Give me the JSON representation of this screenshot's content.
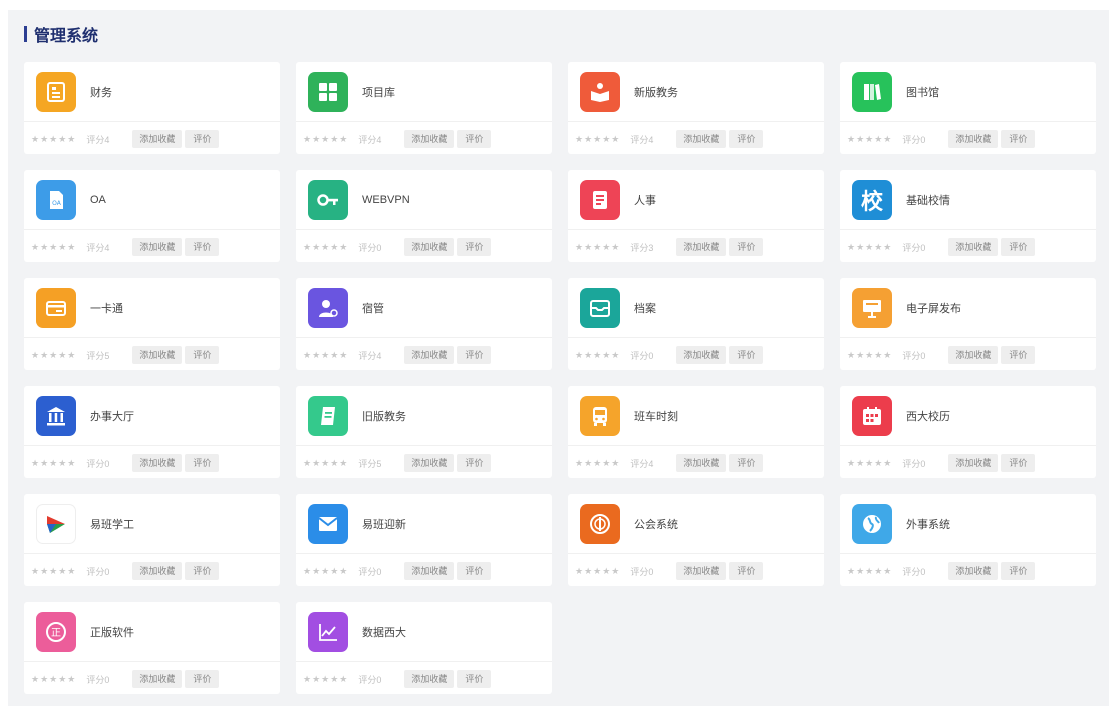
{
  "section": {
    "title": "管理系统"
  },
  "labels": {
    "add_favorite": "添加收藏",
    "rate": "评价",
    "stars": "★★★★★"
  },
  "apps": [
    {
      "name": "财务",
      "rating": "评分4",
      "icon": "finance-icon",
      "color": "#f5a623"
    },
    {
      "name": "项目库",
      "rating": "评分4",
      "icon": "grid-icon",
      "color": "#2fb25a"
    },
    {
      "name": "新版教务",
      "rating": "评分4",
      "icon": "reading-icon",
      "color": "#ef5b3a"
    },
    {
      "name": "图书馆",
      "rating": "评分0",
      "icon": "books-icon",
      "color": "#27c25b"
    },
    {
      "name": "OA",
      "rating": "评分4",
      "icon": "document-icon",
      "color": "#3d9ce8"
    },
    {
      "name": "WEBVPN",
      "rating": "评分0",
      "icon": "key-icon",
      "color": "#27b283"
    },
    {
      "name": "人事",
      "rating": "评分3",
      "icon": "form-icon",
      "color": "#ee4456"
    },
    {
      "name": "基础校情",
      "rating": "评分0",
      "icon": "campus-glyph-icon",
      "color": "#1f8ed6",
      "glyph": "校"
    },
    {
      "name": "一卡通",
      "rating": "评分5",
      "icon": "card-icon",
      "color": "#f5a025"
    },
    {
      "name": "宿管",
      "rating": "评分4",
      "icon": "user-admin-icon",
      "color": "#6a55e0"
    },
    {
      "name": "档案",
      "rating": "评分0",
      "icon": "archive-icon",
      "color": "#1ba69a"
    },
    {
      "name": "电子屏发布",
      "rating": "评分0",
      "icon": "screen-icon",
      "color": "#f5a033"
    },
    {
      "name": "办事大厅",
      "rating": "评分0",
      "icon": "hall-icon",
      "color": "#2c5fd0"
    },
    {
      "name": "旧版教务",
      "rating": "评分5",
      "icon": "notebook-icon",
      "color": "#34c98c"
    },
    {
      "name": "班车时刻",
      "rating": "评分4",
      "icon": "bus-icon",
      "color": "#f5a42b"
    },
    {
      "name": "西大校历",
      "rating": "评分0",
      "icon": "calendar-icon",
      "color": "#ec3d4c"
    },
    {
      "name": "易班学工",
      "rating": "评分0",
      "icon": "yiban-logo-icon",
      "color": "#ffffff"
    },
    {
      "name": "易班迎新",
      "rating": "评分0",
      "icon": "envelope-icon",
      "color": "#2b8de8"
    },
    {
      "name": "公会系统",
      "rating": "评分0",
      "icon": "union-emblem-icon",
      "color": "#ea6a1f"
    },
    {
      "name": "外事系统",
      "rating": "评分0",
      "icon": "globe-icon",
      "color": "#3fa8e8"
    },
    {
      "name": "正版软件",
      "rating": "评分0",
      "icon": "genuine-icon",
      "color": "#ec5d9a"
    },
    {
      "name": "数据西大",
      "rating": "评分0",
      "icon": "chart-line-icon",
      "color": "#a24ee2"
    }
  ]
}
